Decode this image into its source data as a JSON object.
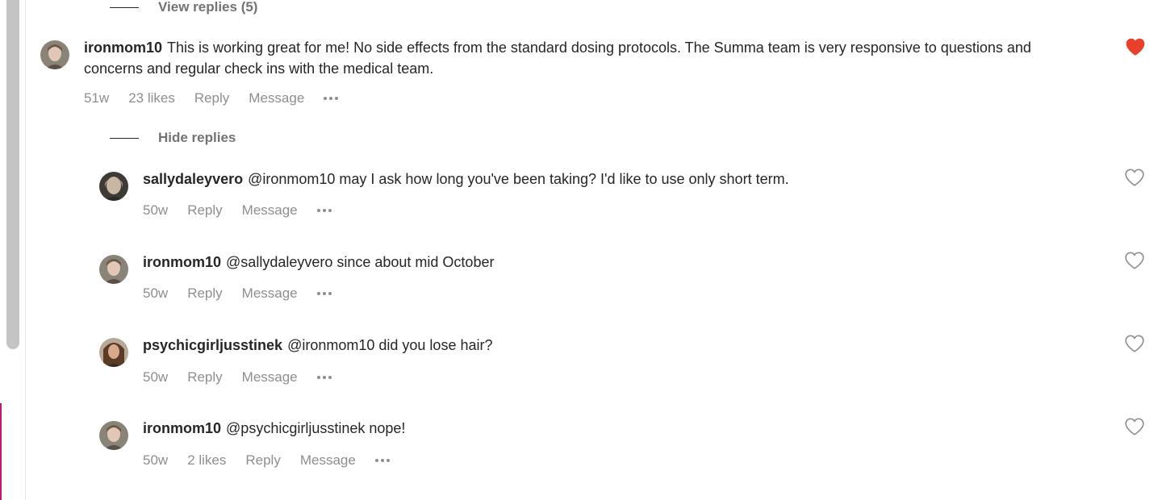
{
  "colors": {
    "heart_filled": "#ed4956",
    "meta_text": "#8e8e8e",
    "toggle_text": "#737373",
    "body_text": "#262626"
  },
  "top_toggle": {
    "label": "View replies (5)"
  },
  "main_comment": {
    "username": "ironmom10",
    "text": "This is working great for me! No side effects from the standard dosing protocols. The Summa team is very responsive to questions and concerns and regular check ins with the medical team.",
    "age": "51w",
    "likes": "23 likes",
    "reply_label": "Reply",
    "message_label": "Message",
    "liked": true,
    "heart_icon": "heart-filled-icon"
  },
  "replies_toggle": {
    "label": "Hide replies"
  },
  "replies": [
    {
      "username": "sallydaleyvero",
      "text": "@ironmom10 may I ask how long you've been taking? I'd like to use only short term.",
      "age": "50w",
      "likes": "",
      "reply_label": "Reply",
      "message_label": "Message",
      "heart_icon": "heart-outline-icon"
    },
    {
      "username": "ironmom10",
      "text": "@sallydaleyvero since about mid October",
      "age": "50w",
      "likes": "",
      "reply_label": "Reply",
      "message_label": "Message",
      "heart_icon": "heart-outline-icon"
    },
    {
      "username": "psychicgirljusstinek",
      "text": "@ironmom10 did you lose hair?",
      "age": "50w",
      "likes": "",
      "reply_label": "Reply",
      "message_label": "Message",
      "heart_icon": "heart-outline-icon"
    },
    {
      "username": "ironmom10",
      "text": "@psychicgirljusstinek nope!",
      "age": "50w",
      "likes": "2 likes",
      "reply_label": "Reply",
      "message_label": "Message",
      "heart_icon": "heart-outline-icon"
    }
  ]
}
